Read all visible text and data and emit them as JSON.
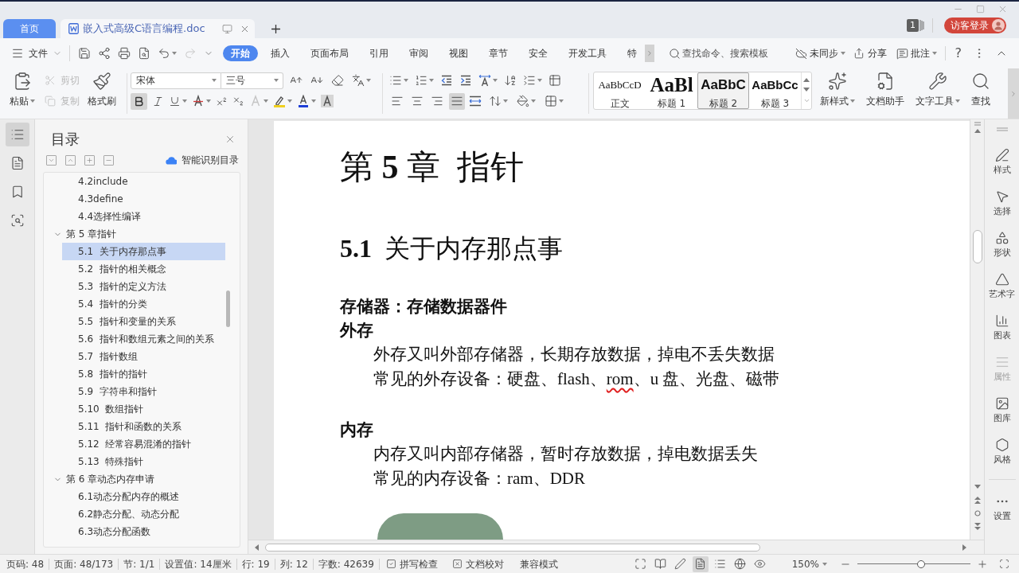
{
  "title_bar": {
    "tabs": [
      {
        "kind": "home",
        "label": "首页",
        "selected": false
      },
      {
        "kind": "document",
        "label": "嵌入式高级C语言编程.doc",
        "selected": true
      }
    ],
    "message_count": "1",
    "login_button": "访客登录"
  },
  "menu_bar": {
    "file_menu": "文件",
    "redo_disabled": true,
    "tabs": [
      {
        "label": "开始",
        "selected": true
      },
      {
        "label": "插入",
        "selected": false
      },
      {
        "label": "页面布局",
        "selected": false
      },
      {
        "label": "引用",
        "selected": false
      },
      {
        "label": "审阅",
        "selected": false
      },
      {
        "label": "视图",
        "selected": false
      },
      {
        "label": "章节",
        "selected": false
      },
      {
        "label": "安全",
        "selected": false
      },
      {
        "label": "开发工具",
        "selected": false
      },
      {
        "label": "特",
        "selected": false
      }
    ],
    "search": {
      "placeholder": "查找命令、搜索模板"
    },
    "sync": "未同步",
    "share": "分享",
    "comments": "批注",
    "help": "?"
  },
  "ribbon": {
    "clipboard": {
      "paste": "粘贴",
      "cut": {
        "label": "剪切",
        "disabled": true
      },
      "copy": {
        "label": "复制",
        "disabled": true
      },
      "format_painter": "格式刷"
    },
    "font": {
      "name": "宋体",
      "size": "三号",
      "bold": true,
      "text_effects_disabled": true
    },
    "align_buttons": [
      {
        "kind": "left",
        "selected": false
      },
      {
        "kind": "center",
        "selected": false
      },
      {
        "kind": "right",
        "selected": false
      },
      {
        "kind": "justify",
        "selected": true
      }
    ],
    "styles": [
      {
        "kind": "body",
        "preview": "AaBbCcD",
        "label": "正文",
        "selected": false
      },
      {
        "kind": "heading-1",
        "preview": "AaBl",
        "label": "标题 1",
        "selected": false
      },
      {
        "kind": "heading-2",
        "preview": "AaBbC",
        "label": "标题 2",
        "selected": true
      },
      {
        "kind": "heading-3",
        "preview": "AaBbCc",
        "label": "标题 3",
        "selected": false
      }
    ],
    "tools": [
      {
        "kind": "new-style",
        "label": "新样式"
      },
      {
        "kind": "doc-assistant",
        "label": "文档助手"
      },
      {
        "kind": "text-tools",
        "label": "文字工具"
      },
      {
        "kind": "find",
        "label": "查找"
      }
    ]
  },
  "nav_strip": [
    {
      "kind": "toc",
      "selected": true
    },
    {
      "kind": "outline",
      "selected": false
    },
    {
      "kind": "bookmark",
      "selected": false
    },
    {
      "kind": "find",
      "selected": false
    }
  ],
  "toc_panel": {
    "title": "目录",
    "smart_detect": "智能识别目录",
    "items": [
      {
        "children": [
          {
            "label": "4.2include",
            "selected": false
          },
          {
            "label": "4.3define",
            "selected": false
          },
          {
            "label": "4.4选择性编译",
            "selected": false
          }
        ]
      },
      {
        "label": "第 5 章指针",
        "selected": false,
        "expanded": true,
        "children": [
          {
            "label": "5.1  关于内存那点事",
            "selected": true
          },
          {
            "label": "5.2  指针的相关概念",
            "selected": false
          },
          {
            "label": "5.3  指针的定义方法",
            "selected": false
          },
          {
            "label": "5.4  指针的分类",
            "selected": false
          },
          {
            "label": "5.5  指针和变量的关系",
            "selected": false
          },
          {
            "label": "5.6  指针和数组元素之间的关系",
            "selected": false
          },
          {
            "label": "5.7  指针数组",
            "selected": false
          },
          {
            "label": "5.8  指针的指针",
            "selected": false
          },
          {
            "label": "5.9  字符串和指针",
            "selected": false
          },
          {
            "label": "5.10  数组指针",
            "selected": false
          },
          {
            "label": "5.11  指针和函数的关系",
            "selected": false
          },
          {
            "label": "5.12  经常容易混淆的指针",
            "selected": false
          },
          {
            "label": "5.13  特殊指针",
            "selected": false
          }
        ]
      },
      {
        "label": "第 6 章动态内存申请",
        "selected": false,
        "expanded": true,
        "children": [
          {
            "label": "6.1动态分配内存的概述",
            "selected": false
          },
          {
            "label": "6.2静态分配、动态分配",
            "selected": false
          },
          {
            "label": "6.3动态分配函数",
            "selected": false
          }
        ]
      }
    ]
  },
  "document": {
    "chapter_title": "第 **5** 章  指针",
    "section_title": "**5.1**  关于内存那点事",
    "blocks": [
      {
        "kind": "heading",
        "text": "存储器：存储数据器件"
      },
      {
        "kind": "heading",
        "text": "外存"
      },
      {
        "kind": "paragraph",
        "runs": [
          {
            "text": "外存又叫外部存储器，长期存放数据，掉电不丢失数据",
            "misspelled": false
          }
        ]
      },
      {
        "kind": "paragraph",
        "runs": [
          {
            "text": "常见的外存设备：硬盘、flash、",
            "misspelled": false
          },
          {
            "text": "rom",
            "misspelled": true
          },
          {
            "text": "、u 盘、光盘、磁带",
            "misspelled": false
          }
        ]
      },
      {
        "kind": "heading",
        "text": "内存"
      },
      {
        "kind": "paragraph",
        "runs": [
          {
            "text": "内存又叫内部存储器，暂时存放数据，掉电数据丢失",
            "misspelled": false
          }
        ]
      },
      {
        "kind": "paragraph",
        "runs": [
          {
            "text": "常见的内存设备：ram、DDR",
            "misspelled": false
          }
        ]
      },
      {
        "kind": "photo"
      }
    ]
  },
  "side_tools": [
    {
      "kind": "style",
      "label": "样式",
      "disabled": false
    },
    {
      "kind": "select",
      "label": "选择",
      "disabled": false
    },
    {
      "kind": "shape",
      "label": "形状",
      "disabled": false
    },
    {
      "kind": "word-art",
      "label": "艺术字",
      "disabled": false
    },
    {
      "kind": "chart",
      "label": "图表",
      "disabled": false
    },
    {
      "kind": "properties",
      "label": "属性",
      "disabled": true
    },
    {
      "kind": "gallery",
      "label": "图库",
      "disabled": false
    },
    {
      "kind": "theme",
      "label": "风格",
      "disabled": false
    },
    {
      "kind": "settings",
      "label": "设置",
      "disabled": false
    }
  ],
  "status_bar": {
    "fields": [
      "页码: 48",
      "页面: 48/173",
      "节: 1/1",
      "设置值: 14厘米",
      "行: 19",
      "列: 12",
      "字数: 42639"
    ],
    "spell_check": "拼写检查",
    "proofread": "文档校对",
    "compat_mode": "兼容模式",
    "view_buttons": [
      {
        "kind": "fullscreen",
        "selected": false
      },
      {
        "kind": "reading",
        "selected": false
      },
      {
        "kind": "writing",
        "selected": false
      },
      {
        "kind": "page",
        "selected": true
      },
      {
        "kind": "outline",
        "selected": false
      },
      {
        "kind": "web",
        "selected": false
      },
      {
        "kind": "eye-care",
        "selected": false
      }
    ],
    "zoom": "150%",
    "zoom_slider": {
      "level": 0.56
    }
  }
}
